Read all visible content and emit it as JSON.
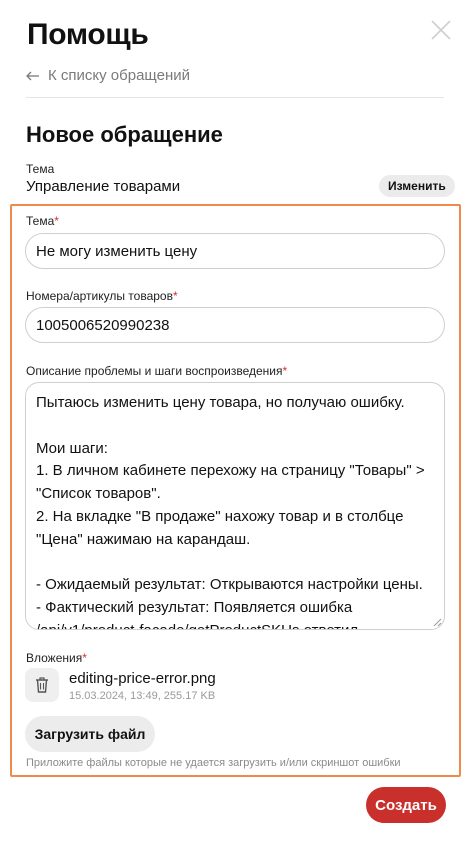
{
  "header": {
    "title": "Помощь",
    "back_link": "К списку обращений"
  },
  "form": {
    "section_title": "Новое обращение",
    "topic_caption": "Тема",
    "topic_value": "Управление товарами",
    "change_button": "Изменить",
    "subject": {
      "label": "Тема",
      "required_mark": "*",
      "value": "Не могу изменить цену"
    },
    "articles": {
      "label": "Номера/артикулы товаров",
      "required_mark": "*",
      "value": "1005006520990238"
    },
    "description": {
      "label": "Описание проблемы и шаги воспроизведения",
      "required_mark": "*",
      "value": "Пытаюсь изменить цену товара, но получаю ошибку.\n\nМои шаги:\n1. В личном кабинете перехожу на страницу \"Товары\" > \"Список товаров\".\n2. На вкладке \"В продаже\" нахожу товар и в столбце \"Цена\" нажимаю на карандаш.\n\n- Ожидаемый результат: Открываются настройки цены.\n- Фактический результат: Появляется ошибка /api/v1/product-facade/getProductSKUs ответил"
    },
    "attachments": {
      "label": "Вложения",
      "required_mark": "*",
      "file_name": "editing-price-error.png",
      "file_meta": "15.03.2024, 13:49, 255.17 KB",
      "upload_button": "Загрузить файл",
      "hint": "Приложите файлы которые не удается загрузить и/или скриншот ошибки"
    },
    "submit_button": "Создать"
  },
  "colors": {
    "accent_red": "#c9302c",
    "highlight_border": "#ef8a4a"
  },
  "icons": [
    "close-icon",
    "arrow-left-icon",
    "trash-icon",
    "resize-handle-icon"
  ]
}
